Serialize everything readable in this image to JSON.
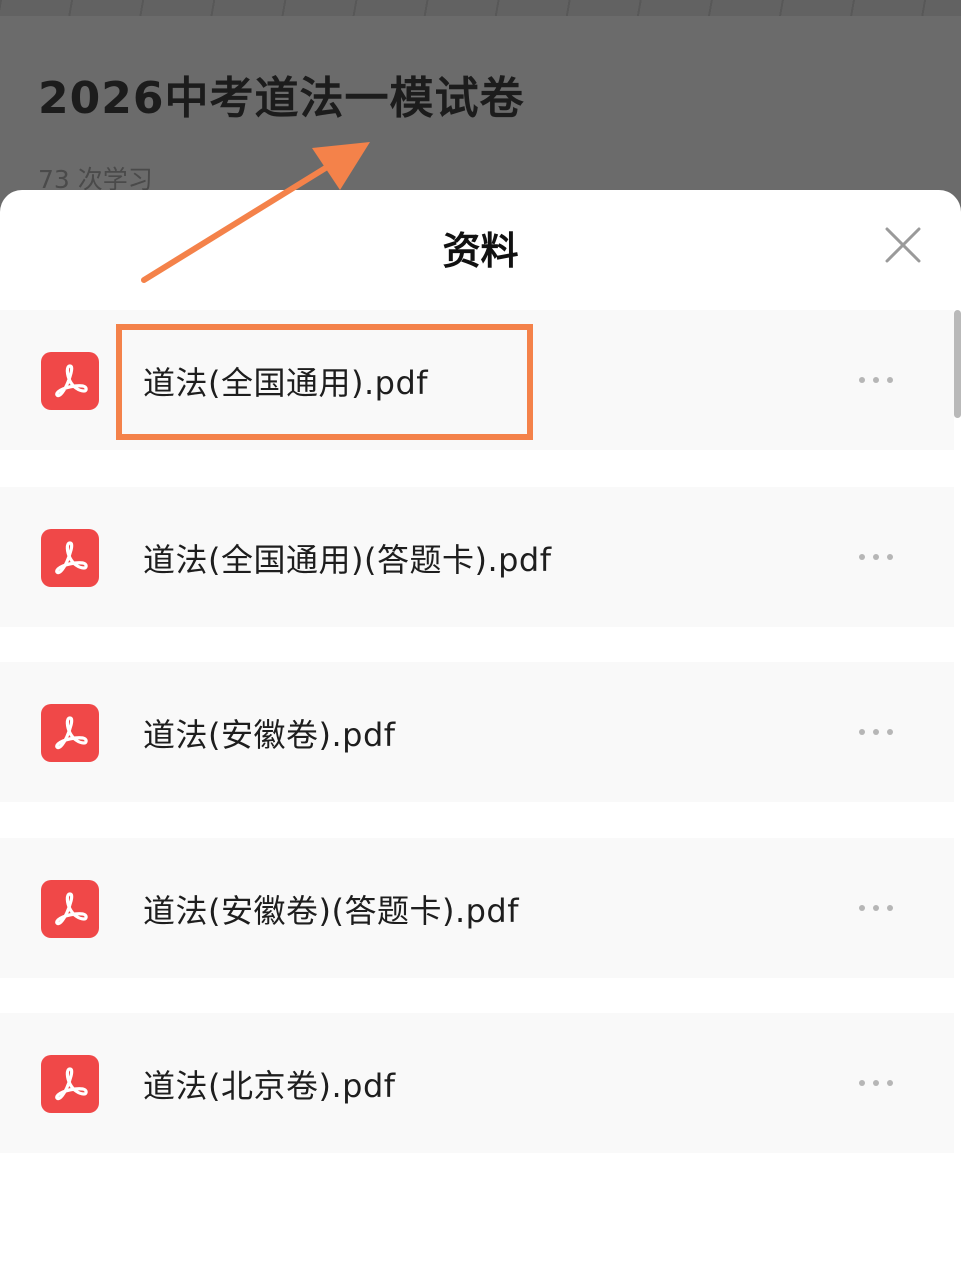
{
  "background_page": {
    "title": "2026中考道法一模试卷",
    "study_count": "73 次学习"
  },
  "sheet": {
    "title": "资料",
    "close_icon": "close-icon"
  },
  "files": [
    {
      "name": "道法(全国通用).pdf",
      "icon": "pdf-icon"
    },
    {
      "name": "道法(全国通用)(答题卡).pdf",
      "icon": "pdf-icon"
    },
    {
      "name": "道法(安徽卷).pdf",
      "icon": "pdf-icon"
    },
    {
      "name": "道法(安徽卷)(答题卡).pdf",
      "icon": "pdf-icon"
    },
    {
      "name": "道法(北京卷).pdf",
      "icon": "pdf-icon"
    }
  ],
  "colors": {
    "pdf_red": "#f04848",
    "annotation_orange": "#f4824a",
    "overlay_gray": "#6b6b6b"
  }
}
